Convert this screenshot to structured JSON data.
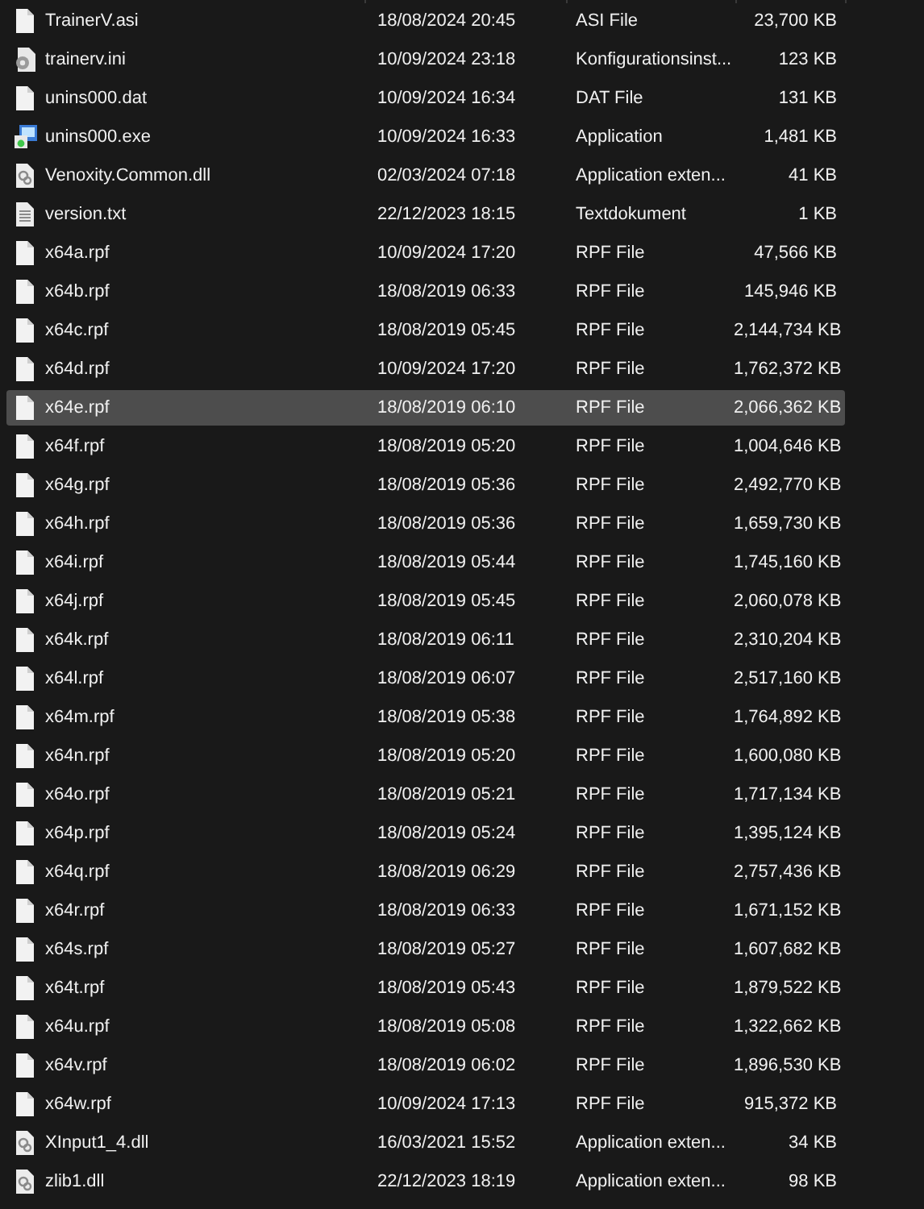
{
  "files": [
    {
      "kind": "file",
      "name": "TrainerV.asi",
      "modified": "18/08/2024 20:45",
      "type": "ASI File",
      "size": "23,700 KB",
      "selected": false
    },
    {
      "kind": "config",
      "name": "trainerv.ini",
      "modified": "10/09/2024 23:18",
      "type": "Konfigurationsinst...",
      "size": "123 KB",
      "selected": false
    },
    {
      "kind": "file",
      "name": "unins000.dat",
      "modified": "10/09/2024 16:34",
      "type": "DAT File",
      "size": "131 KB",
      "selected": false
    },
    {
      "kind": "app",
      "name": "unins000.exe",
      "modified": "10/09/2024 16:33",
      "type": "Application",
      "size": "1,481 KB",
      "selected": false
    },
    {
      "kind": "library",
      "name": "Venoxity.Common.dll",
      "modified": "02/03/2024 07:18",
      "type": "Application exten...",
      "size": "41 KB",
      "selected": false
    },
    {
      "kind": "text",
      "name": "version.txt",
      "modified": "22/12/2023 18:15",
      "type": "Textdokument",
      "size": "1 KB",
      "selected": false
    },
    {
      "kind": "file",
      "name": "x64a.rpf",
      "modified": "10/09/2024 17:20",
      "type": "RPF File",
      "size": "47,566 KB",
      "selected": false
    },
    {
      "kind": "file",
      "name": "x64b.rpf",
      "modified": "18/08/2019 06:33",
      "type": "RPF File",
      "size": "145,946 KB",
      "selected": false
    },
    {
      "kind": "file",
      "name": "x64c.rpf",
      "modified": "18/08/2019 05:45",
      "type": "RPF File",
      "size": "2,144,734 KB",
      "selected": false
    },
    {
      "kind": "file",
      "name": "x64d.rpf",
      "modified": "10/09/2024 17:20",
      "type": "RPF File",
      "size": "1,762,372 KB",
      "selected": false
    },
    {
      "kind": "file",
      "name": "x64e.rpf",
      "modified": "18/08/2019 06:10",
      "type": "RPF File",
      "size": "2,066,362 KB",
      "selected": true
    },
    {
      "kind": "file",
      "name": "x64f.rpf",
      "modified": "18/08/2019 05:20",
      "type": "RPF File",
      "size": "1,004,646 KB",
      "selected": false
    },
    {
      "kind": "file",
      "name": "x64g.rpf",
      "modified": "18/08/2019 05:36",
      "type": "RPF File",
      "size": "2,492,770 KB",
      "selected": false
    },
    {
      "kind": "file",
      "name": "x64h.rpf",
      "modified": "18/08/2019 05:36",
      "type": "RPF File",
      "size": "1,659,730 KB",
      "selected": false
    },
    {
      "kind": "file",
      "name": "x64i.rpf",
      "modified": "18/08/2019 05:44",
      "type": "RPF File",
      "size": "1,745,160 KB",
      "selected": false
    },
    {
      "kind": "file",
      "name": "x64j.rpf",
      "modified": "18/08/2019 05:45",
      "type": "RPF File",
      "size": "2,060,078 KB",
      "selected": false
    },
    {
      "kind": "file",
      "name": "x64k.rpf",
      "modified": "18/08/2019 06:11",
      "type": "RPF File",
      "size": "2,310,204 KB",
      "selected": false
    },
    {
      "kind": "file",
      "name": "x64l.rpf",
      "modified": "18/08/2019 06:07",
      "type": "RPF File",
      "size": "2,517,160 KB",
      "selected": false
    },
    {
      "kind": "file",
      "name": "x64m.rpf",
      "modified": "18/08/2019 05:38",
      "type": "RPF File",
      "size": "1,764,892 KB",
      "selected": false
    },
    {
      "kind": "file",
      "name": "x64n.rpf",
      "modified": "18/08/2019 05:20",
      "type": "RPF File",
      "size": "1,600,080 KB",
      "selected": false
    },
    {
      "kind": "file",
      "name": "x64o.rpf",
      "modified": "18/08/2019 05:21",
      "type": "RPF File",
      "size": "1,717,134 KB",
      "selected": false
    },
    {
      "kind": "file",
      "name": "x64p.rpf",
      "modified": "18/08/2019 05:24",
      "type": "RPF File",
      "size": "1,395,124 KB",
      "selected": false
    },
    {
      "kind": "file",
      "name": "x64q.rpf",
      "modified": "18/08/2019 06:29",
      "type": "RPF File",
      "size": "2,757,436 KB",
      "selected": false
    },
    {
      "kind": "file",
      "name": "x64r.rpf",
      "modified": "18/08/2019 06:33",
      "type": "RPF File",
      "size": "1,671,152 KB",
      "selected": false
    },
    {
      "kind": "file",
      "name": "x64s.rpf",
      "modified": "18/08/2019 05:27",
      "type": "RPF File",
      "size": "1,607,682 KB",
      "selected": false
    },
    {
      "kind": "file",
      "name": "x64t.rpf",
      "modified": "18/08/2019 05:43",
      "type": "RPF File",
      "size": "1,879,522 KB",
      "selected": false
    },
    {
      "kind": "file",
      "name": "x64u.rpf",
      "modified": "18/08/2019 05:08",
      "type": "RPF File",
      "size": "1,322,662 KB",
      "selected": false
    },
    {
      "kind": "file",
      "name": "x64v.rpf",
      "modified": "18/08/2019 06:02",
      "type": "RPF File",
      "size": "1,896,530 KB",
      "selected": false
    },
    {
      "kind": "file",
      "name": "x64w.rpf",
      "modified": "10/09/2024 17:13",
      "type": "RPF File",
      "size": "915,372 KB",
      "selected": false
    },
    {
      "kind": "library",
      "name": "XInput1_4.dll",
      "modified": "16/03/2021 15:52",
      "type": "Application exten...",
      "size": "34 KB",
      "selected": false
    },
    {
      "kind": "library",
      "name": "zlib1.dll",
      "modified": "22/12/2023 18:19",
      "type": "Application exten...",
      "size": "98 KB",
      "selected": false
    }
  ]
}
